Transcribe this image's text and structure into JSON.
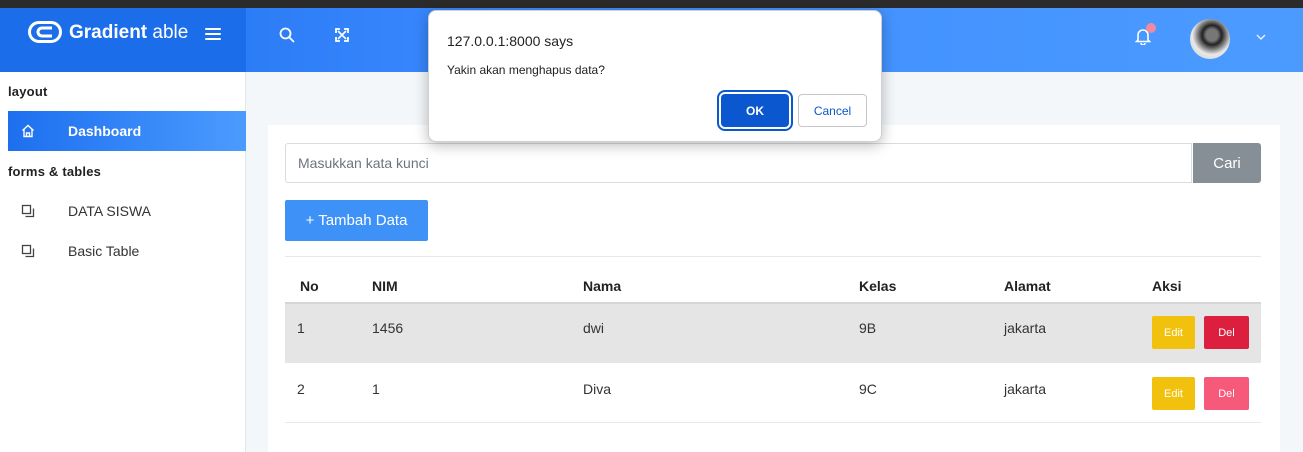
{
  "brand": {
    "name_bold": "Gradient",
    "name_light": " able"
  },
  "sidebar": {
    "caption_layout": "layout",
    "caption_forms": "forms & tables",
    "items": [
      {
        "label": "Dashboard",
        "icon": "home-icon",
        "active": true
      },
      {
        "label": "DATA SISWA",
        "icon": "copy-icon",
        "active": false
      },
      {
        "label": "Basic Table",
        "icon": "copy-icon",
        "active": false
      }
    ]
  },
  "search": {
    "placeholder": "Masukkan kata kunci",
    "button_label": "Cari"
  },
  "add_button_label": "+ Tambah Data",
  "table": {
    "headers": [
      "No",
      "NIM",
      "Nama",
      "Kelas",
      "Alamat",
      "Aksi"
    ],
    "rows": [
      {
        "no": "1",
        "nim": "1456",
        "nama": "dwi",
        "kelas": "9B",
        "alamat": "jakarta",
        "edit": "Edit",
        "del": "Del"
      },
      {
        "no": "2",
        "nim": "1",
        "nama": "Diva",
        "kelas": "9C",
        "alamat": "jakarta",
        "edit": "Edit",
        "del": "Del"
      }
    ]
  },
  "dialog": {
    "title": "127.0.0.1:8000 says",
    "message": "Yakin akan menghapus data?",
    "ok_label": "OK",
    "cancel_label": "Cancel"
  },
  "colors": {
    "primary": "#1d6fef",
    "edit": "#f2c10e",
    "delete_hover": "#dc1f3f",
    "delete": "#f6597a",
    "secondary": "#878f96"
  }
}
